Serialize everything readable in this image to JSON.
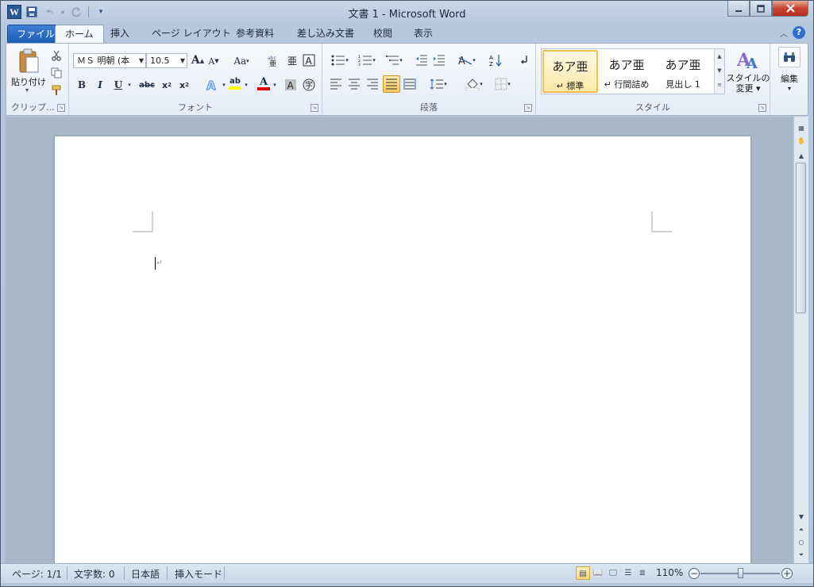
{
  "window": {
    "title": "文書 1 - Microsoft Word",
    "minimize": "–",
    "maximize": "□",
    "close": "✕"
  },
  "qat": {
    "app_icon": "W",
    "save": "💾",
    "undo": "↶",
    "redo": "↷",
    "customize": "▾"
  },
  "tabs": [
    {
      "label": "ファイル"
    },
    {
      "label": "ホーム"
    },
    {
      "label": "挿入"
    },
    {
      "label": "ページ レイアウト"
    },
    {
      "label": "参考資料"
    },
    {
      "label": "差し込み文書"
    },
    {
      "label": "校閲"
    },
    {
      "label": "表示"
    }
  ],
  "ribbon": {
    "clipboard": {
      "paste_label": "貼り付け",
      "group_label": "クリップ..."
    },
    "font": {
      "font_name": "ＭＳ 明朝 (本",
      "font_size": "10.5",
      "group_label": "フォント",
      "bold": "B",
      "italic": "I",
      "underline": "U",
      "strike": "abc",
      "grow": "A",
      "shrink": "A",
      "case": "Aa",
      "highlight": "ab",
      "font_color": "A"
    },
    "paragraph": {
      "group_label": "段落"
    },
    "styles": {
      "group_label": "スタイル",
      "items": [
        {
          "preview": "あア亜",
          "name": "↵ 標準"
        },
        {
          "preview": "あア亜",
          "name": "↵ 行間詰め"
        },
        {
          "preview": "あア亜",
          "name": "見出し 1"
        }
      ],
      "change_label": "スタイルの変更",
      "change_line1": "スタイルの",
      "change_line2": "変更 ▾"
    },
    "editing": {
      "label": "編集"
    }
  },
  "document": {
    "paragraph_mark": "↵"
  },
  "status": {
    "page": "ページ: 1/1",
    "words": "文字数: 0",
    "language": "日本語",
    "mode": "挿入モード",
    "zoom": "110%"
  },
  "colors": {
    "file_tab": "#1d5cb4",
    "highlight_yellow": "#ffff00",
    "font_red": "#e00000",
    "selected_style": "#f2c14e"
  }
}
